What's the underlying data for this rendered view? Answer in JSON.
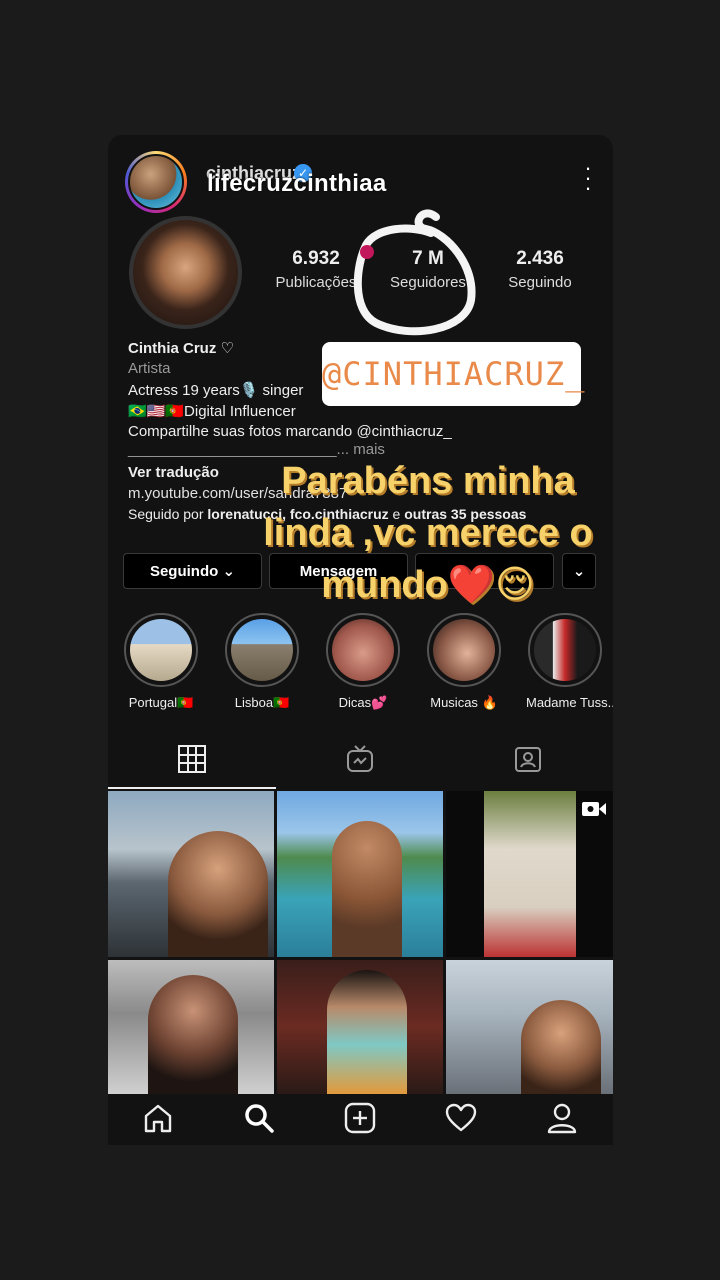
{
  "header": {
    "username_small": "cinthiacruz",
    "story_username": "lifecruzcinthiaa"
  },
  "profile": {
    "stats": [
      {
        "num": "6.932",
        "label": "Publicações"
      },
      {
        "num": "7 M",
        "label": "Seguidores"
      },
      {
        "num": "2.436",
        "label": "Seguindo"
      }
    ],
    "name": "Cinthia Cruz ♡",
    "category": "Artista",
    "bio_line1": "Actress 19 years🎙️ singer",
    "bio_line2": "🇧🇷🇺🇸🇵🇹Digital Influencer",
    "bio_line3": "Compartilhe suas fotos marcando @cinthiacruz_",
    "bio_line4": "_________________________... mais",
    "translate": "Ver tradução",
    "link": "m.youtube.com/user/sandra7887",
    "followed_by_prefix": "Seguido por ",
    "followed_by_names": "lorenatucci, fco.cinthiacruz",
    "followed_by_suffix": " e ",
    "followed_by_others": "outras 35 pessoas"
  },
  "stickers": {
    "handle": "@CINTHIACRUZ_",
    "congrats": "Parabéns minha linda ,vc merece o mundo❤️😌"
  },
  "buttons": {
    "following": "Seguindo ⌄",
    "message": "Mensagem",
    "contact": "",
    "more": "⌄"
  },
  "highlights": [
    {
      "label": "Portugal🇵🇹"
    },
    {
      "label": "Lisboa🇵🇹"
    },
    {
      "label": "Dicas💕"
    },
    {
      "label": "Musicas 🔥"
    },
    {
      "label": "Madame Tuss..."
    }
  ],
  "icons": {
    "grid": "grid-icon",
    "igtv": "igtv-icon",
    "tagged": "tagged-icon",
    "home": "home-icon",
    "search": "search-icon",
    "add": "add-post-icon",
    "activity": "heart-icon",
    "profile": "profile-icon",
    "video": "video-icon"
  },
  "colors": {
    "congrats_text": "#f7d26a",
    "handle_text": "#e98a4a",
    "verified": "#3897f0"
  }
}
